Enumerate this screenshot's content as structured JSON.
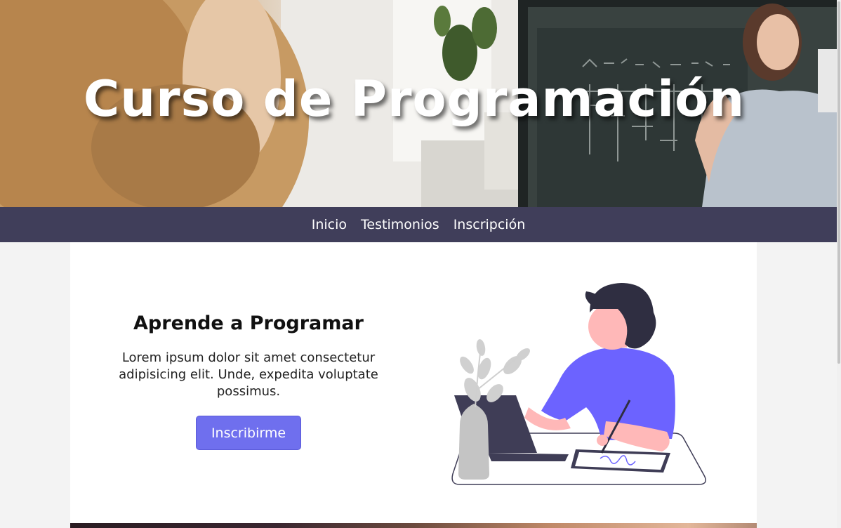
{
  "hero": {
    "title": "Curso de Programación"
  },
  "nav": {
    "items": [
      {
        "label": "Inicio"
      },
      {
        "label": "Testimonios"
      },
      {
        "label": "Inscripción"
      }
    ]
  },
  "intro": {
    "heading": "Aprende a Programar",
    "text": "Lorem ipsum dolor sit amet consectetur adipisicing elit. Unde, expedita voluptate possimus.",
    "button_label": "Inscribirme"
  },
  "colors": {
    "nav_bg": "#403e5a",
    "accent": "#6f6fee",
    "page_bg": "#f3f3f3",
    "card_bg": "#ffffff"
  },
  "icons": {
    "illustration": "person-drawing-on-tablet-illustration"
  }
}
